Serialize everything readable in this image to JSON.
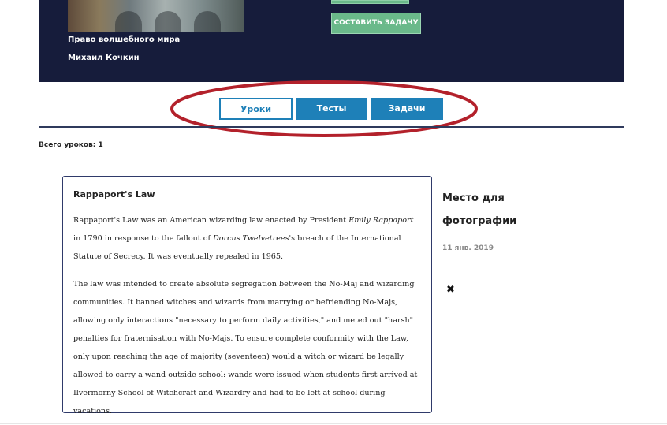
{
  "course": {
    "title": "Право волшебного мира",
    "author": "Михаил Кочкин",
    "create_task_button": "СОСТАВИТЬ ЗАДАЧУ"
  },
  "tabs": [
    {
      "label": "Уроки",
      "active": true
    },
    {
      "label": "Тесты",
      "active": false
    },
    {
      "label": "Задачи",
      "active": false
    }
  ],
  "lesson_count_label": "Всего уроков: 1",
  "lesson": {
    "title": "Rappaport's Law",
    "paragraph1_parts": [
      "Rappaport's Law was an American wizarding law enacted by President ",
      "Emily Rappaport",
      " in 1790 in response to the fallout of ",
      "Dorcus Twelvetrees",
      "'s breach of the International Statute of Secrecy. It was eventually repealed in 1965."
    ],
    "paragraph2": "The law was intended to create absolute segregation between the No-Maj and wizarding communities. It banned witches and wizards from marrying or befriending No-Majs, allowing only interactions \"necessary to perform daily activities,\" and meted out \"harsh\" penalties for fraternisation with No-Majs. To ensure complete conformity with the Law, only upon reaching the age of majority (seventeen) would a witch or wizard be legally allowed to carry a wand outside school: wands were issued when students first arrived at Ilvermorny School of Witchcraft and Wizardry and had to be left at school during vacations."
  },
  "side": {
    "title": "Место для фотографии",
    "date": "11 янв. 2019",
    "delete_icon": "✖"
  },
  "colors": {
    "header_bg": "#161c3b",
    "accent_blue": "#1e80b8",
    "green_button": "#6ab98a",
    "annotation_red": "#b3212b"
  }
}
